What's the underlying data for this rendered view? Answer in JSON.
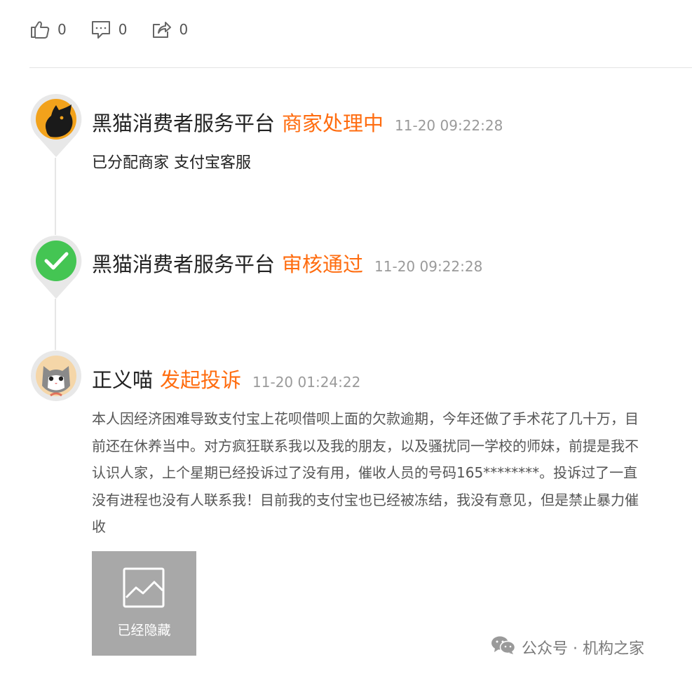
{
  "stats": {
    "likes": "0",
    "comments": "0",
    "shares": "0"
  },
  "timeline": [
    {
      "author": "黑猫消费者服务平台",
      "status": "商家处理中",
      "time": "11-20 09:22:28",
      "detail": "已分配商家 支付宝客服"
    },
    {
      "author": "黑猫消费者服务平台",
      "status": "审核通过",
      "time": "11-20 09:22:28"
    },
    {
      "author": "正义喵",
      "status": "发起投诉",
      "time": "11-20 01:24:22",
      "content_lines": [
        "本人因经济困难导致支付宝上花呗借呗上面的欠款逾期，今年还做了手术花了几十万，目",
        "前还在休养当中。对方疯狂联系我以及我的朋友，以及骚扰同一学校的师妹，前提是我不",
        "认识人家，上个星期已经投诉过了没有用，催收人员的号码165********。投诉过了一直",
        "没有进程也没有人联系我！目前我的支付宝也已经被冻结，我没有意见，但是禁止暴力催",
        "收"
      ],
      "attachment_label": "已经隐藏"
    }
  ],
  "watermark": "公众号 · 机构之家",
  "colors": {
    "accent": "#ff6c0f",
    "time": "#9a9a9a",
    "approve": "#44c553",
    "hidden_image": "#a8a8a8"
  },
  "icons": [
    "thumbs-up-icon",
    "comment-icon",
    "share-icon",
    "black-cat-avatar",
    "check-avatar",
    "cat-avatar",
    "image-icon",
    "wechat-icon"
  ]
}
